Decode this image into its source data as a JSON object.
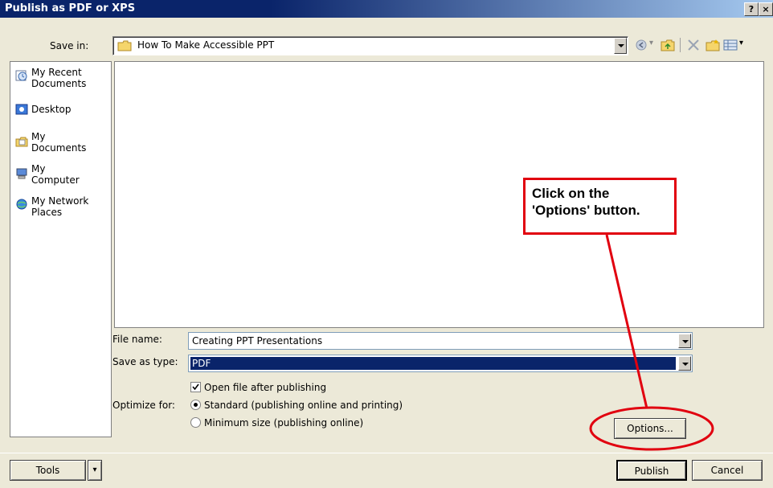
{
  "window": {
    "title": "Publish as PDF or XPS"
  },
  "titlebar": {
    "help": "?",
    "close": "×"
  },
  "save_in": {
    "label": "Save in:",
    "folder": "How To Make Accessible PPT"
  },
  "places": [
    {
      "line1": "My Recent",
      "line2": "Documents"
    },
    {
      "line1": "Desktop",
      "line2": ""
    },
    {
      "line1": "My",
      "line2": "Documents"
    },
    {
      "line1": "My",
      "line2": "Computer"
    },
    {
      "line1": "My Network",
      "line2": "Places"
    }
  ],
  "file_name": {
    "label": "File name:",
    "value": "Creating PPT Presentations"
  },
  "save_as_type": {
    "label": "Save as type:",
    "value": "PDF"
  },
  "open_after": {
    "label": "Open file after publishing",
    "checked": true
  },
  "optimize": {
    "label": "Optimize for:",
    "standard": "Standard (publishing online and printing)",
    "minimum": "Minimum size (publishing online)"
  },
  "buttons": {
    "options": "Options...",
    "tools": "Tools",
    "publish": "Publish",
    "cancel": "Cancel"
  },
  "callout": {
    "line1": "Click on the",
    "line2": "'Options' button."
  },
  "colors": {
    "annotation": "#e1000f",
    "selection": "#0a246a",
    "titlebar": "#0a246a"
  }
}
